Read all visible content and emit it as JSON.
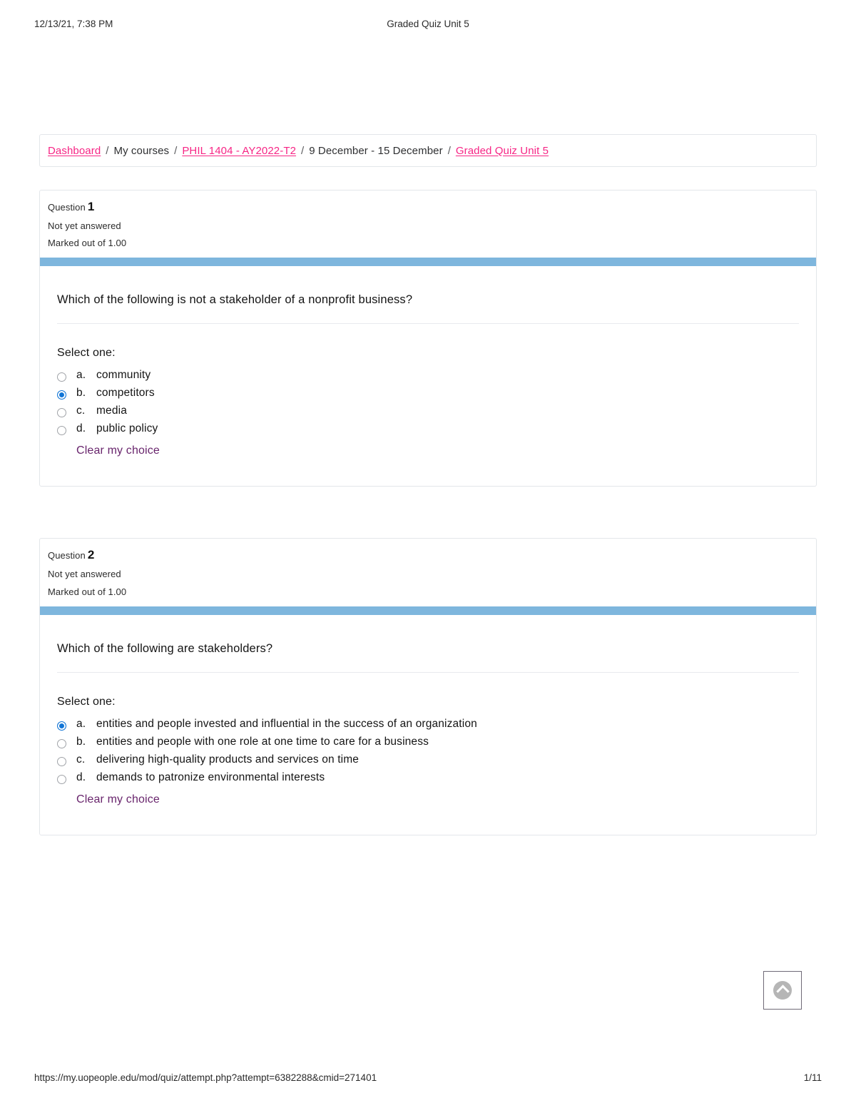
{
  "print_header": {
    "timestamp": "12/13/21, 7:38 PM",
    "doc_title": "Graded Quiz Unit 5"
  },
  "print_footer": {
    "url": "https://my.uopeople.edu/mod/quiz/attempt.php?attempt=6382288&cmid=271401",
    "page": "1/11"
  },
  "breadcrumb": {
    "separator": "/",
    "items": [
      {
        "label": "Dashboard",
        "link": true
      },
      {
        "label": "My courses",
        "link": false
      },
      {
        "label": "PHIL 1404 - AY2022-T2",
        "link": true
      },
      {
        "label": "9 December - 15 December",
        "link": false
      },
      {
        "label": "Graded Quiz Unit 5",
        "link": true
      }
    ]
  },
  "colors": {
    "breadcrumb_link": "#f72585",
    "question_bar": "#7eb6dd",
    "clear_choice_link": "#68246c",
    "radio_selected": "#1175d6",
    "card_border": "#e3e6ea"
  },
  "questions": [
    {
      "number_label": "Question",
      "number": "1",
      "state": "Not yet answered",
      "grade": "Marked out of 1.00",
      "text": "Which of the following is not a stakeholder of a nonprofit business?",
      "select_label": "Select one:",
      "clear_label": "Clear my choice",
      "options": [
        {
          "letter": "a.",
          "text": "community",
          "selected": false
        },
        {
          "letter": "b.",
          "text": "competitors",
          "selected": true
        },
        {
          "letter": "c.",
          "text": "media",
          "selected": false
        },
        {
          "letter": "d.",
          "text": "public policy",
          "selected": false
        }
      ]
    },
    {
      "number_label": "Question",
      "number": "2",
      "state": "Not yet answered",
      "grade": "Marked out of 1.00",
      "text": "Which of the following are stakeholders?",
      "select_label": "Select one:",
      "clear_label": "Clear my choice",
      "options": [
        {
          "letter": "a.",
          "text": "entities and people invested and influential in the success of an organization",
          "selected": true
        },
        {
          "letter": "b.",
          "text": "entities and people with one role at one time to care for a business",
          "selected": false
        },
        {
          "letter": "c.",
          "text": "delivering high-quality products and services on time",
          "selected": false
        },
        {
          "letter": "d.",
          "text": "demands to patronize environmental interests",
          "selected": false
        }
      ]
    }
  ],
  "scroll_top_button": {
    "label": "Go to top"
  }
}
